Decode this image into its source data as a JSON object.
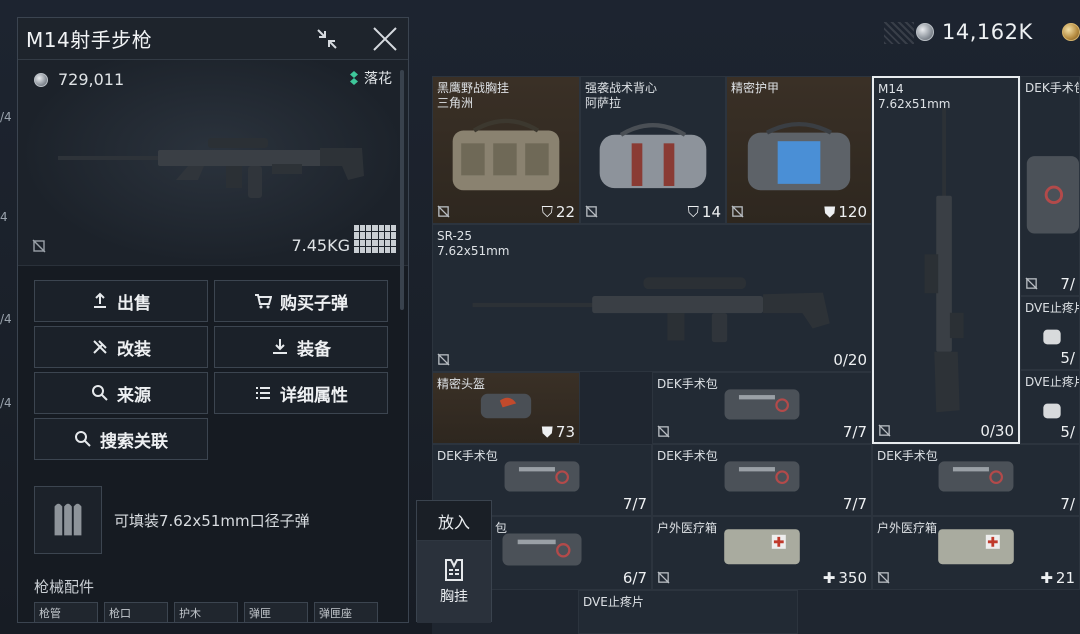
{
  "currency": {
    "amount": "14,162K"
  },
  "left_strip": [
    "/4",
    "4",
    "/4",
    "/4"
  ],
  "panel": {
    "title": "M14射手步枪",
    "price": "729,011",
    "tag": "落花",
    "weight": "7.45KG",
    "buttons": [
      {
        "label": "出售",
        "icon": "sell-icon"
      },
      {
        "label": "购买子弹",
        "icon": "cart-icon"
      },
      {
        "label": "改装",
        "icon": "wrench-icon"
      },
      {
        "label": "装备",
        "icon": "download-icon"
      },
      {
        "label": "来源",
        "icon": "search-icon"
      },
      {
        "label": "详细属性",
        "icon": "list-icon"
      },
      {
        "label": "搜索关联",
        "icon": "search-icon"
      }
    ],
    "ammo_text": "可填装7.62x51mm口径子弹",
    "parts_title": "枪械配件",
    "parts": [
      "枪管",
      "枪口",
      "护木",
      "弹匣",
      "弹匣座"
    ]
  },
  "putin": {
    "label": "放入",
    "slot_label": "胸挂"
  },
  "inventory": {
    "items": [
      {
        "name": "黑鹰野战胸挂",
        "sub": "三角洲",
        "count": "22",
        "count_icon": "vest-icon"
      },
      {
        "name": "强袭战术背心",
        "sub": "阿萨拉",
        "count": "14",
        "count_icon": "vest-icon"
      },
      {
        "name": "精密护甲",
        "sub": "",
        "count": "120",
        "count_icon": "shield-icon"
      },
      {
        "name": "M14",
        "sub": "7.62x51mm",
        "count": "0/30",
        "count_icon": ""
      },
      {
        "name": "DEK手术包",
        "sub": "",
        "count": "7/",
        "count_icon": ""
      },
      {
        "name": "SR-25",
        "sub": "7.62x51mm",
        "count": "0/20",
        "count_icon": ""
      },
      {
        "name": "DVE止疼片",
        "sub": "",
        "count": "5/",
        "count_icon": ""
      },
      {
        "name": "精密头盔",
        "sub": "",
        "count": "73",
        "count_icon": "shield-icon"
      },
      {
        "name": "DEK手术包",
        "sub": "",
        "count": "7/7",
        "count_icon": ""
      },
      {
        "name": "DVE止疼片",
        "sub": "",
        "count": "5/",
        "count_icon": ""
      },
      {
        "name": "DEK手术包",
        "sub": "",
        "count": "7/7",
        "count_icon": ""
      },
      {
        "name": "DEK手术包",
        "sub": "",
        "count": "7/7",
        "count_icon": ""
      },
      {
        "name": "DEK手术包",
        "sub": "",
        "count": "7/",
        "count_icon": ""
      },
      {
        "name": "包",
        "sub": "",
        "count": "6/7",
        "count_icon": ""
      },
      {
        "name": "户外医疗箱",
        "sub": "",
        "count": "350",
        "count_icon": "plus-icon"
      },
      {
        "name": "户外医疗箱",
        "sub": "",
        "count": "21",
        "count_icon": "plus-icon"
      },
      {
        "name": "DVE止疼片",
        "sub": "",
        "count": "",
        "count_icon": ""
      }
    ]
  }
}
